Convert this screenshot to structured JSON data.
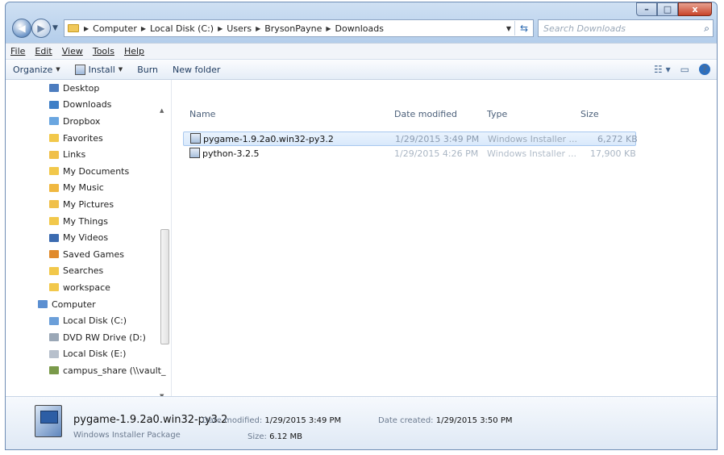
{
  "window": {
    "minimize": "–",
    "maximize": "□",
    "close": "x"
  },
  "nav": {
    "back": "◀",
    "forward": "▶"
  },
  "address": {
    "crumbs": [
      "Computer",
      "Local Disk (C:)",
      "Users",
      "BrysonPayne",
      "Downloads"
    ]
  },
  "search": {
    "placeholder": "Search Downloads"
  },
  "menu": {
    "items": [
      "File",
      "Edit",
      "View",
      "Tools",
      "Help"
    ]
  },
  "toolbar": {
    "organize": "Organize",
    "install": "Install",
    "burn": "Burn",
    "new_folder": "New folder"
  },
  "sidebar": {
    "items": [
      {
        "label": "Desktop",
        "color": "#4d7dbf"
      },
      {
        "label": "Downloads",
        "color": "#3f7fc7"
      },
      {
        "label": "Dropbox",
        "color": "#6aa6e0"
      },
      {
        "label": "Favorites",
        "color": "#f2c84b"
      },
      {
        "label": "Links",
        "color": "#f0c04a"
      },
      {
        "label": "My Documents",
        "color": "#f2c84b"
      },
      {
        "label": "My Music",
        "color": "#f0b840"
      },
      {
        "label": "My Pictures",
        "color": "#f0c04a"
      },
      {
        "label": "My Things",
        "color": "#f2c84b"
      },
      {
        "label": "My Videos",
        "color": "#3b6bb0"
      },
      {
        "label": "Saved Games",
        "color": "#e08a2c"
      },
      {
        "label": "Searches",
        "color": "#f2c84b"
      },
      {
        "label": "workspace",
        "color": "#f2c84b"
      },
      {
        "label": "Computer",
        "color": "#5b8fd1"
      },
      {
        "label": "Local Disk (C:)",
        "color": "#6b9fd9"
      },
      {
        "label": "DVD RW Drive (D:)",
        "color": "#9aa7b6"
      },
      {
        "label": "Local Disk (E:)",
        "color": "#b7c0cc"
      },
      {
        "label": "campus_share (\\\\vault_",
        "color": "#7a9a4a"
      }
    ]
  },
  "columns": {
    "name": "Name",
    "date": "Date modified",
    "type": "Type",
    "size": "Size"
  },
  "files": [
    {
      "name": "pygame-1.9.2a0.win32-py3.2",
      "date": "1/29/2015 3:49 PM",
      "type": "Windows Installer ...",
      "size": "6,272 KB",
      "selected": true
    },
    {
      "name": "python-3.2.5",
      "date": "1/29/2015 4:26 PM",
      "type": "Windows Installer ...",
      "size": "17,900 KB",
      "selected": false
    }
  ],
  "details": {
    "name": "pygame-1.9.2a0.win32-py3.2",
    "type": "Windows Installer Package",
    "date_modified_label": "Date modified:",
    "date_modified": "1/29/2015 3:49 PM",
    "size_label": "Size:",
    "size": "6.12 MB",
    "date_created_label": "Date created:",
    "date_created": "1/29/2015 3:50 PM"
  }
}
